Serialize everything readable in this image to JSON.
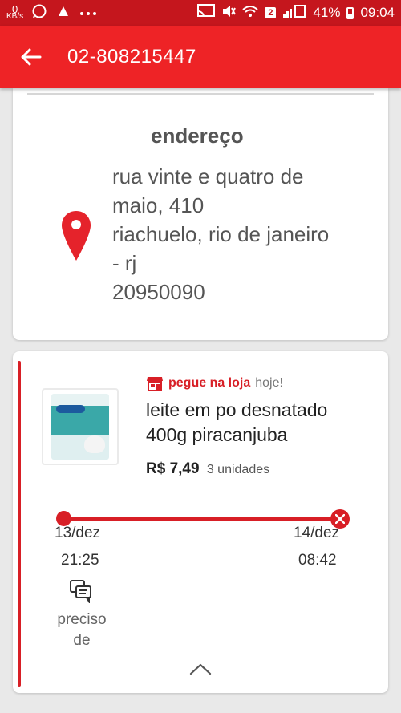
{
  "status_bar": {
    "kbs_value": "0",
    "kbs_unit": "KB/s",
    "badge": "2",
    "battery": "41%",
    "time": "09:04",
    "icons": [
      "whatsapp-icon",
      "notification-icon",
      "more-icon",
      "cast-icon",
      "mute-icon",
      "wifi-icon",
      "signal-icon",
      "battery-icon"
    ]
  },
  "header": {
    "title": "02-808215447"
  },
  "address": {
    "heading": "endereço",
    "lines": [
      "rua vinte e quatro de",
      "maio, 410",
      "riachuelo, rio de janeiro",
      "- rj",
      "20950090"
    ]
  },
  "order": {
    "pickup_label": "pegue na loja",
    "pickup_when": "hoje!",
    "product_name_lines": [
      "leite em po desnatado",
      "400g piracanjuba"
    ],
    "price": "R$ 7,49",
    "quantity": "3 unidades",
    "timeline": {
      "start_date": "13/dez",
      "start_time": "21:25",
      "end_date": "14/dez",
      "end_time": "08:42"
    },
    "chat_label_lines": [
      "preciso",
      "de"
    ]
  },
  "colors": {
    "status_bar": "#c5161d",
    "app_bar": "#ee2326",
    "accent": "#d81f26"
  }
}
